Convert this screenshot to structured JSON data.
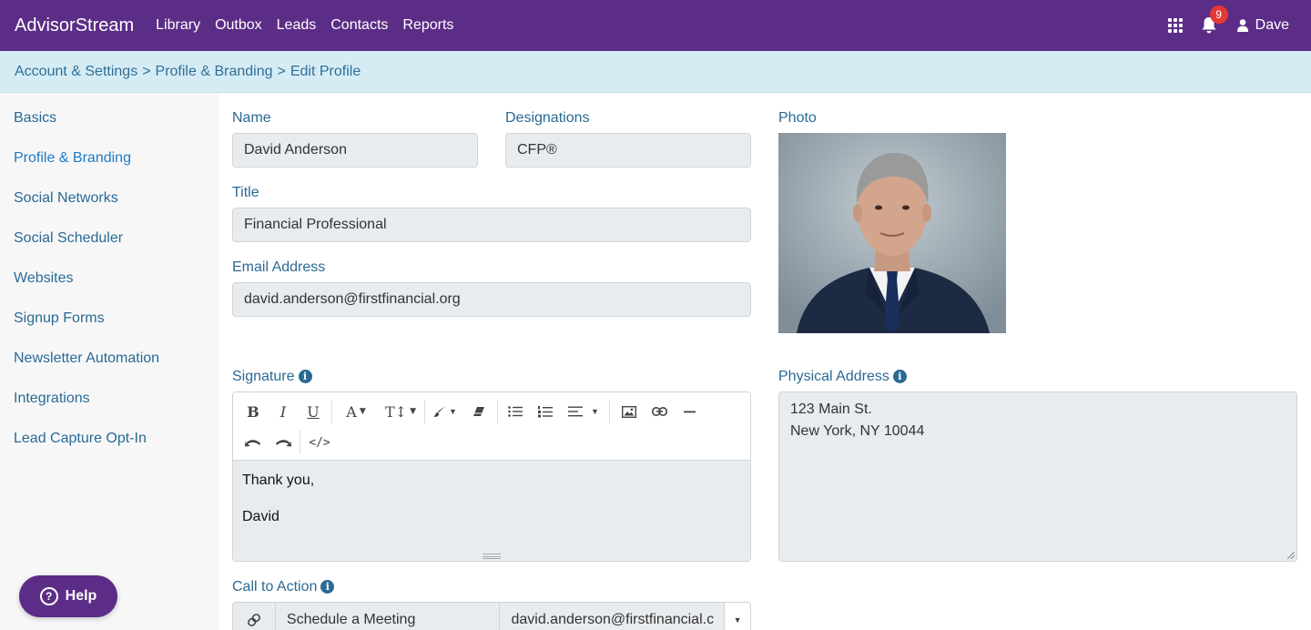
{
  "app": {
    "brand": "AdvisorStream",
    "nav": [
      "Library",
      "Outbox",
      "Leads",
      "Contacts",
      "Reports"
    ],
    "notification_count": "9",
    "user_name": "Dave"
  },
  "breadcrumb": [
    "Account & Settings",
    "Profile & Branding",
    "Edit Profile"
  ],
  "breadcrumb_separator": ">",
  "sidebar": {
    "items": [
      "Basics",
      "Profile & Branding",
      "Social Networks",
      "Social Scheduler",
      "Websites",
      "Signup Forms",
      "Newsletter Automation",
      "Integrations",
      "Lead Capture Opt-In"
    ],
    "active": "Profile & Branding"
  },
  "form": {
    "name_label": "Name",
    "name_value": "David Anderson",
    "designations_label": "Designations",
    "designations_value": "CFP®",
    "title_label": "Title",
    "title_value": "Financial Professional",
    "email_label": "Email Address",
    "email_value": "david.anderson@firstfinancial.org",
    "photo_label": "Photo",
    "signature_label": "Signature",
    "signature_lines": [
      "Thank you,",
      "David"
    ],
    "address_label": "Physical Address",
    "address_lines": [
      "123 Main St.",
      "New York, NY 10044"
    ],
    "cta_label": "Call to Action",
    "cta_type": "Schedule a Meeting",
    "cta_value": "david.anderson@firstfinancial.c"
  },
  "editor_toolbar": {
    "code_glyph": "</>"
  },
  "help_label": "Help",
  "colors": {
    "brand_purple": "#5c2d86",
    "breadcrumb_bg": "#d6ecf5",
    "link_blue": "#2a6a93",
    "badge_red": "#e53935"
  }
}
